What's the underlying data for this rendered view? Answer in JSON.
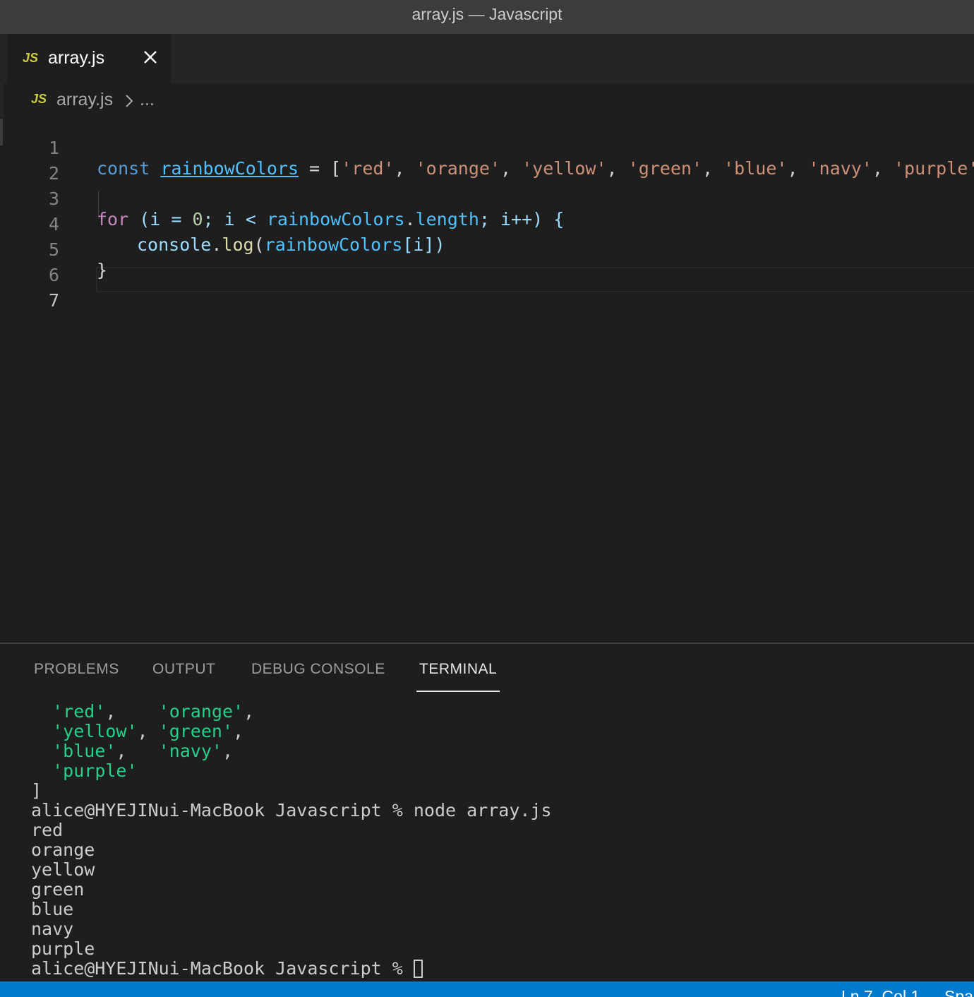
{
  "window": {
    "title": "array.js — Javascript"
  },
  "tab": {
    "icon_text": "JS",
    "label": "array.js",
    "close_icon": "close-icon"
  },
  "breadcrumb": {
    "icon_text": "JS",
    "file": "array.js",
    "separator_icon": "chevron-right-icon",
    "more": "..."
  },
  "editor": {
    "lines": [
      {
        "number": "1"
      },
      {
        "number": "2"
      },
      {
        "number": "3"
      },
      {
        "number": "4"
      },
      {
        "number": "5"
      },
      {
        "number": "6"
      },
      {
        "number": "7"
      }
    ],
    "tokens": {
      "const": "const",
      "var": "rainbowColors",
      "eq": " = ",
      "lb": "[",
      "s_red": "'red'",
      "s_orange": "'orange'",
      "s_yellow": "'yellow'",
      "s_green": "'green'",
      "s_blue": "'blue'",
      "s_navy": "'navy'",
      "s_purple": "'purple'",
      "comma": ", ",
      "rb": "]",
      "for": "for",
      "paren_i": " (i = ",
      "zero": "0",
      "semi_i": "; i < ",
      "length": "length",
      "semi_ipp": "; i++) {",
      "dot": ".",
      "console": "console",
      "log": "log",
      "open": "(",
      "idx": "[i])",
      "close_brace": "}"
    }
  },
  "panel": {
    "tabs": [
      "PROBLEMS",
      "OUTPUT",
      "DEBUG CONSOLE",
      "TERMINAL"
    ],
    "active_tab": "TERMINAL",
    "terminal": {
      "array_output": [
        [
          "'red'",
          "'orange'"
        ],
        [
          "'yellow'",
          "'green'"
        ],
        [
          "'blue'",
          "'navy'"
        ],
        [
          "'purple'"
        ]
      ],
      "close_bracket": "]",
      "prompt": "alice@HYEJINui-MacBook Javascript % ",
      "command": "node array.js",
      "output": [
        "red",
        "orange",
        "yellow",
        "green",
        "blue",
        "navy",
        "purple"
      ]
    }
  },
  "status": {
    "position": "Ln 7, Col 1",
    "spaces": "Spa"
  },
  "colors": {
    "statusbar": "#007acc",
    "terminal_string": "#23d18b",
    "keyword": "#569cd6",
    "string": "#ce9178"
  }
}
